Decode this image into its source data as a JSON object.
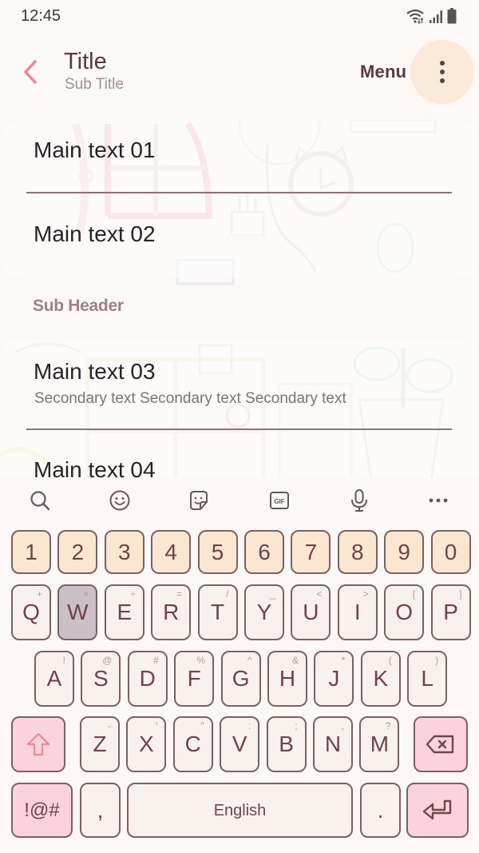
{
  "status_bar": {
    "time": "12:45",
    "icons": [
      "wifi-icon",
      "signal-icon",
      "battery-icon"
    ]
  },
  "app_bar": {
    "back_icon": "chevron-left-icon",
    "title": "Title",
    "subtitle": "Sub Title",
    "menu_label": "Menu",
    "more_icon": "more-vertical-icon"
  },
  "list": {
    "group1": [
      {
        "main": "Main text 01"
      },
      {
        "main": "Main text 02"
      }
    ],
    "sub_header": "Sub Header",
    "group2": [
      {
        "main": "Main text 03",
        "secondary": "Secondary text Secondary text Secondary text"
      },
      {
        "main": "Main text 04"
      }
    ]
  },
  "keyboard": {
    "toolbar": [
      "search-icon",
      "emoji-icon",
      "sticker-icon",
      "gif-icon",
      "microphone-icon",
      "more-horizontal-icon"
    ],
    "gif_label": "GIF",
    "numbers": [
      "1",
      "2",
      "3",
      "4",
      "5",
      "6",
      "7",
      "8",
      "9",
      "0"
    ],
    "row1": [
      {
        "k": "Q",
        "h": "+"
      },
      {
        "k": "W",
        "h": "×"
      },
      {
        "k": "E",
        "h": "÷"
      },
      {
        "k": "R",
        "h": "="
      },
      {
        "k": "T",
        "h": "/"
      },
      {
        "k": "Y",
        "h": "_"
      },
      {
        "k": "U",
        "h": "<"
      },
      {
        "k": "I",
        "h": ">"
      },
      {
        "k": "O",
        "h": "["
      },
      {
        "k": "P",
        "h": "]"
      }
    ],
    "row2": [
      {
        "k": "A",
        "h": "!"
      },
      {
        "k": "S",
        "h": "@"
      },
      {
        "k": "D",
        "h": "#"
      },
      {
        "k": "F",
        "h": "%"
      },
      {
        "k": "G",
        "h": "^"
      },
      {
        "k": "H",
        "h": "&"
      },
      {
        "k": "J",
        "h": "*"
      },
      {
        "k": "K",
        "h": "("
      },
      {
        "k": "L",
        "h": ")"
      }
    ],
    "row3": [
      {
        "k": "Z",
        "h": "-"
      },
      {
        "k": "X",
        "h": "'"
      },
      {
        "k": "C",
        "h": "\""
      },
      {
        "k": "V",
        "h": ":"
      },
      {
        "k": "B",
        "h": ";"
      },
      {
        "k": "N",
        "h": ","
      },
      {
        "k": "M",
        "h": "?"
      }
    ],
    "pressed_key": "W",
    "shift_icon": "shift-icon",
    "backspace_icon": "backspace-icon",
    "symbols_label": "!@#",
    "comma_label": ",",
    "space_label": "English",
    "period_label": ".",
    "enter_icon": "enter-icon"
  },
  "colors": {
    "accent": "#e88a93",
    "text_primary": "#5b3a3e",
    "number_key": "#fbe6d2",
    "letter_key": "#f9f1ee",
    "function_key": "#fbd3dc",
    "pressed_key": "#cbbfc8",
    "more_button": "#fbe9d9"
  }
}
